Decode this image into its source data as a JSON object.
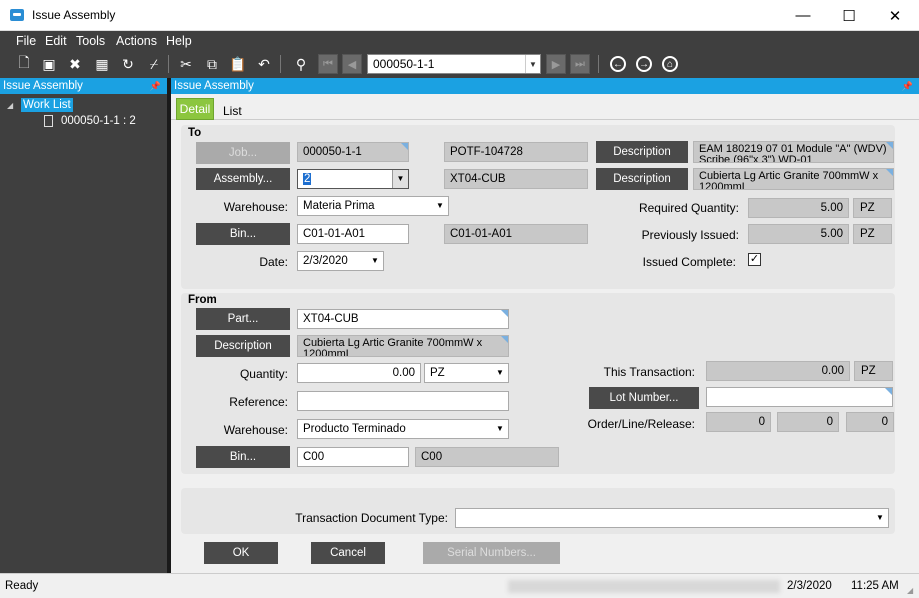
{
  "window": {
    "title": "Issue Assembly"
  },
  "menu": [
    "File",
    "Edit",
    "Tools",
    "Actions",
    "Help"
  ],
  "toolbar": {
    "record": "000050-1-1"
  },
  "left_panel": {
    "header": "Issue Assembly",
    "tree_root": "Work List",
    "tree_child": "000050-1-1 : 2"
  },
  "main_header": "Issue Assembly",
  "tabs": {
    "detail": "Detail",
    "list": "List"
  },
  "to": {
    "label": "To",
    "job_btn": "Job...",
    "job": "000050-1-1",
    "job_ref": "POTF-104728",
    "desc_btn": "Description",
    "job_desc": "EAM 180219 07 01 Module \"A\" (WDV) Scribe (96\"x 3\") WD-01",
    "assembly_btn": "Assembly...",
    "assembly": "2",
    "assembly_part": "XT04-CUB",
    "desc_btn2": "Description",
    "assembly_desc": "Cubierta Lg Artic Granite 700mmW x 1200mmL",
    "warehouse_lbl": "Warehouse:",
    "warehouse": "Materia Prima",
    "bin_btn": "Bin...",
    "bin": "C01-01-A01",
    "bin_desc": "C01-01-A01",
    "date_lbl": "Date:",
    "date": "2/3/2020",
    "req_qty_lbl": "Required Quantity:",
    "req_qty": "5.00",
    "req_uom": "PZ",
    "prev_lbl": "Previously Issued:",
    "prev_qty": "5.00",
    "prev_uom": "PZ",
    "complete_lbl": "Issued Complete:",
    "complete": "✓"
  },
  "from": {
    "label": "From",
    "part_btn": "Part...",
    "part": "XT04-CUB",
    "desc_btn": "Description",
    "desc": "Cubierta Lg Artic Granite 700mmW x 1200mmL",
    "qty_lbl": "Quantity:",
    "qty": "0.00",
    "qty_uom": "PZ",
    "ref_lbl": "Reference:",
    "ref": "",
    "warehouse_lbl": "Warehouse:",
    "warehouse": "Producto Terminado",
    "bin_btn": "Bin...",
    "bin": "C00",
    "bin_desc": "C00",
    "trans_lbl": "This Transaction:",
    "trans_qty": "0.00",
    "trans_uom": "PZ",
    "lot_btn": "Lot Number...",
    "lot": "",
    "olr_lbl": "Order/Line/Release:",
    "order": "0",
    "line": "0",
    "release": "0"
  },
  "doc_type_lbl": "Transaction Document Type:",
  "doc_type": "",
  "buttons": {
    "ok": "OK",
    "cancel": "Cancel",
    "serial": "Serial Numbers..."
  },
  "status": {
    "text": "Ready",
    "date": "2/3/2020",
    "time": "11:25 AM"
  }
}
